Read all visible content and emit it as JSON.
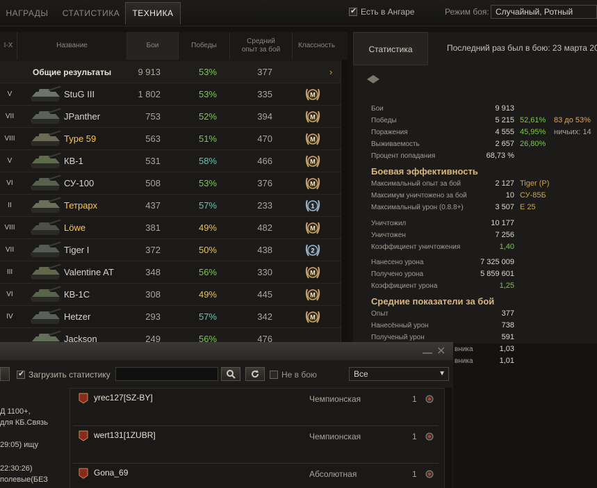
{
  "tabs": [
    {
      "label": "НАГРАДЫ"
    },
    {
      "label": "СТАТИСТИКА"
    },
    {
      "label": "ТЕХНИКА"
    }
  ],
  "in_hangar": {
    "label": "Есть в Ангаре",
    "checked": true
  },
  "battle_mode": {
    "label": "Режим боя:",
    "value": "Случайный, Ротный"
  },
  "table": {
    "headers": {
      "tier": "I-X",
      "name": "Название",
      "battles": "Бои",
      "wins": "Победы",
      "avg_xp": "Средний опыт за бой",
      "mastery": "Классность"
    },
    "summary": {
      "label": "Общие результаты",
      "battles": "9 913",
      "wins": "53%",
      "avg_xp": "377"
    },
    "rows": [
      {
        "tier": "V",
        "name": "StuG III",
        "battles": "1 802",
        "wins": "53%",
        "avg_xp": "335",
        "mastery": "M",
        "premium": false,
        "win_color": "green"
      },
      {
        "tier": "VII",
        "name": "JPanther",
        "battles": "753",
        "wins": "52%",
        "avg_xp": "394",
        "mastery": "M",
        "premium": false,
        "win_color": "green"
      },
      {
        "tier": "VIII",
        "name": "Type 59",
        "battles": "563",
        "wins": "51%",
        "avg_xp": "470",
        "mastery": "M",
        "premium": true,
        "win_color": "green"
      },
      {
        "tier": "V",
        "name": "КВ-1",
        "battles": "531",
        "wins": "58%",
        "avg_xp": "466",
        "mastery": "M",
        "premium": false,
        "win_color": "teal"
      },
      {
        "tier": "VI",
        "name": "СУ-100",
        "battles": "508",
        "wins": "53%",
        "avg_xp": "376",
        "mastery": "M",
        "premium": false,
        "win_color": "green"
      },
      {
        "tier": "II",
        "name": "Тетрарх",
        "battles": "437",
        "wins": "57%",
        "avg_xp": "233",
        "mastery": "1",
        "premium": true,
        "win_color": "teal"
      },
      {
        "tier": "VIII",
        "name": "Löwe",
        "battles": "381",
        "wins": "49%",
        "avg_xp": "482",
        "mastery": "M",
        "premium": true,
        "win_color": "yellow"
      },
      {
        "tier": "VII",
        "name": "Tiger I",
        "battles": "372",
        "wins": "50%",
        "avg_xp": "438",
        "mastery": "2",
        "premium": false,
        "win_color": "yellow"
      },
      {
        "tier": "III",
        "name": "Valentine AT",
        "battles": "348",
        "wins": "56%",
        "avg_xp": "330",
        "mastery": "M",
        "premium": false,
        "win_color": "green"
      },
      {
        "tier": "VI",
        "name": "КВ-1С",
        "battles": "308",
        "wins": "49%",
        "avg_xp": "445",
        "mastery": "M",
        "premium": false,
        "win_color": "yellow"
      },
      {
        "tier": "IV",
        "name": "Hetzer",
        "battles": "293",
        "wins": "57%",
        "avg_xp": "342",
        "mastery": "M",
        "premium": false,
        "win_color": "teal"
      },
      {
        "tier": "",
        "name": "Jackson",
        "battles": "249",
        "wins": "56%",
        "avg_xp": "476",
        "mastery": "",
        "premium": false,
        "win_color": "green"
      }
    ]
  },
  "stats": {
    "tab_label": "Статистика",
    "last_battle": "Последний раз был в бою: 23 марта 20",
    "battles_label": "Бои",
    "battles_value": "9 913",
    "wins_label": "Победы",
    "wins_value": "5 215",
    "wins_pct": "52,61%",
    "wins_extra": "83 до 53%",
    "losses_label": "Поражения",
    "losses_value": "4 555",
    "losses_pct": "45,95%",
    "draws_extra": "ничьих: 14",
    "survival_label": "Выживаемость",
    "survival_value": "2 657",
    "survival_pct": "26,80%",
    "hit_label": "Процент попадания",
    "hit_value": "68,73 %",
    "combat_heading": "Боевая эффективность",
    "max_xp_label": "Максимальный опыт за бой",
    "max_xp_value": "2 127",
    "max_xp_tank": "Tiger (P)",
    "max_kills_label": "Максимум уничтожено за бой",
    "max_kills_value": "10",
    "max_kills_tank": "СУ-85Б",
    "max_dmg_label": "Максимальный урон (0.8.8+)",
    "max_dmg_value": "3 507",
    "max_dmg_tank": "E 25",
    "destroyed_label": "Уничтожил",
    "destroyed_value": "10 177",
    "died_label": "Уничтожен",
    "died_value": "7 256",
    "kd_label": "Коэффициент уничтожения",
    "kd_value": "1,40",
    "dmg_dealt_label": "Нанесено урона",
    "dmg_dealt_value": "7 325 009",
    "dmg_recv_label": "Получено урона",
    "dmg_recv_value": "5 859 601",
    "dmg_ratio_label": "Коэффициент урона",
    "dmg_ratio_value": "1,25",
    "avg_heading": "Средние показатели за бой",
    "avg_xp_label": "Опыт",
    "avg_xp_value": "377",
    "avg_dmg_label": "Нанесённый урон",
    "avg_dmg_value": "738",
    "avg_recv_label": "Полученый урон",
    "avg_recv_value": "591",
    "partial1_label": "вника",
    "partial1_value": "1,03",
    "partial2_label": "вника",
    "partial2_value": "1,01"
  },
  "chat": {
    "load_stats": {
      "label": "Загрузить статистику",
      "checked": true
    },
    "search_placeholder": "",
    "not_in_battle": {
      "label": "Не в бою",
      "checked": false
    },
    "filter": "Все",
    "left_text": [
      "Д 1100+,",
      "для КБ.Связь",
      "29:05) ищу",
      "22:30:26)",
      "полевые(БЕЗ"
    ],
    "players": [
      {
        "name": "yrec127[SZ-BY]",
        "league": "Чемпионская",
        "count": "1"
      },
      {
        "name": "wert131[1ZUBR]",
        "league": "Чемпионская",
        "count": "1"
      },
      {
        "name": "Gona_69",
        "league": "Абсолютная",
        "count": "1"
      }
    ]
  },
  "colors": {
    "win_green": "#7bc94a",
    "win_yellow": "#e6c54f",
    "win_teal": "#5fc7b4",
    "premium_gold": "#ffc44f",
    "heading_gold": "#d9b77e",
    "percent_green": "#7bc94a",
    "extra_orange": "#e8a34d"
  }
}
